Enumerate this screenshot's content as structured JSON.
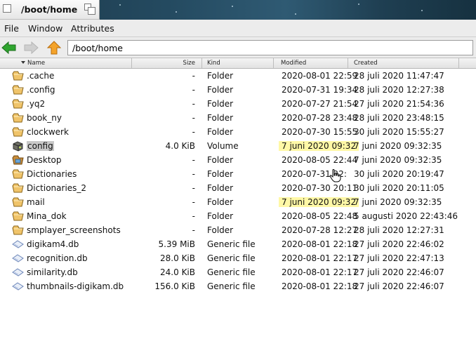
{
  "window": {
    "title": "/boot/home"
  },
  "menu": [
    "File",
    "Window",
    "Attributes"
  ],
  "toolbar": {
    "back_icon": "back-arrow-icon",
    "forward_icon": "forward-arrow-icon",
    "up_icon": "up-arrow-icon",
    "path": "/boot/home"
  },
  "columns": {
    "name": "Name",
    "size": "Size",
    "kind": "Kind",
    "modified": "Modified",
    "created": "Created"
  },
  "colors": {
    "highlight": "#fff8a6",
    "folder": "#f0c46a",
    "back_arrow": "#2fa52f",
    "up_arrow": "#f4a32a"
  },
  "files": [
    {
      "name": ".cache",
      "size": "-",
      "kind": "Folder",
      "modified": "2020-08-01 22:59",
      "created": "28 juli 2020 11:47:47",
      "icon": "folder"
    },
    {
      "name": ".config",
      "size": "-",
      "kind": "Folder",
      "modified": "2020-07-31 19:34",
      "created": "28 juli 2020 12:27:38",
      "icon": "folder"
    },
    {
      "name": ".yq2",
      "size": "-",
      "kind": "Folder",
      "modified": "2020-07-27 21:54",
      "created": "27 juli 2020 21:54:36",
      "icon": "folder"
    },
    {
      "name": "book_ny",
      "size": "-",
      "kind": "Folder",
      "modified": "2020-07-28 23:48",
      "created": "28 juli 2020 23:48:15",
      "icon": "folder"
    },
    {
      "name": "clockwerk",
      "size": "-",
      "kind": "Folder",
      "modified": "2020-07-30 15:55",
      "created": "30 juli 2020 15:55:27",
      "icon": "folder"
    },
    {
      "name": "config",
      "size": "4.0 KiB",
      "kind": "Volume",
      "modified": "7 juni 2020 09:32",
      "created": "7 juni 2020 09:32:35",
      "icon": "volume",
      "selected": true,
      "highlight": true
    },
    {
      "name": "Desktop",
      "size": "-",
      "kind": "Folder",
      "modified": "2020-08-05 22:44",
      "created": "7 juni 2020 09:32:35",
      "icon": "desktop"
    },
    {
      "name": "Dictionaries",
      "size": "-",
      "kind": "Folder",
      "modified": "2020-07-31 22:",
      "created": "30 juli 2020 20:19:47",
      "icon": "folder"
    },
    {
      "name": "Dictionaries_2",
      "size": "-",
      "kind": "Folder",
      "modified": "2020-07-30 20:11",
      "created": "30 juli 2020 20:11:05",
      "icon": "folder"
    },
    {
      "name": "mail",
      "size": "-",
      "kind": "Folder",
      "modified": "7 juni 2020 09:32",
      "created": "7 juni 2020 09:32:35",
      "icon": "folder",
      "highlight": true
    },
    {
      "name": "Mina_dok",
      "size": "-",
      "kind": "Folder",
      "modified": "2020-08-05 22:48",
      "created": "5 augusti 2020 22:43:46",
      "icon": "folder"
    },
    {
      "name": "smplayer_screenshots",
      "size": "-",
      "kind": "Folder",
      "modified": "2020-07-28 12:27",
      "created": "28 juli 2020 12:27:31",
      "icon": "folder"
    },
    {
      "name": "digikam4.db",
      "size": "5.39 MiB",
      "kind": "Generic file",
      "modified": "2020-08-01 22:18",
      "created": "27 juli 2020 22:46:02",
      "icon": "file"
    },
    {
      "name": "recognition.db",
      "size": "28.0 KiB",
      "kind": "Generic file",
      "modified": "2020-08-01 22:17",
      "created": "27 juli 2020 22:47:13",
      "icon": "file"
    },
    {
      "name": "similarity.db",
      "size": "24.0 KiB",
      "kind": "Generic file",
      "modified": "2020-08-01 22:17",
      "created": "27 juli 2020 22:46:07",
      "icon": "file"
    },
    {
      "name": "thumbnails-digikam.db",
      "size": "156.0 KiB",
      "kind": "Generic file",
      "modified": "2020-08-01 22:18",
      "created": "27 juli 2020 22:46:07",
      "icon": "file"
    }
  ]
}
